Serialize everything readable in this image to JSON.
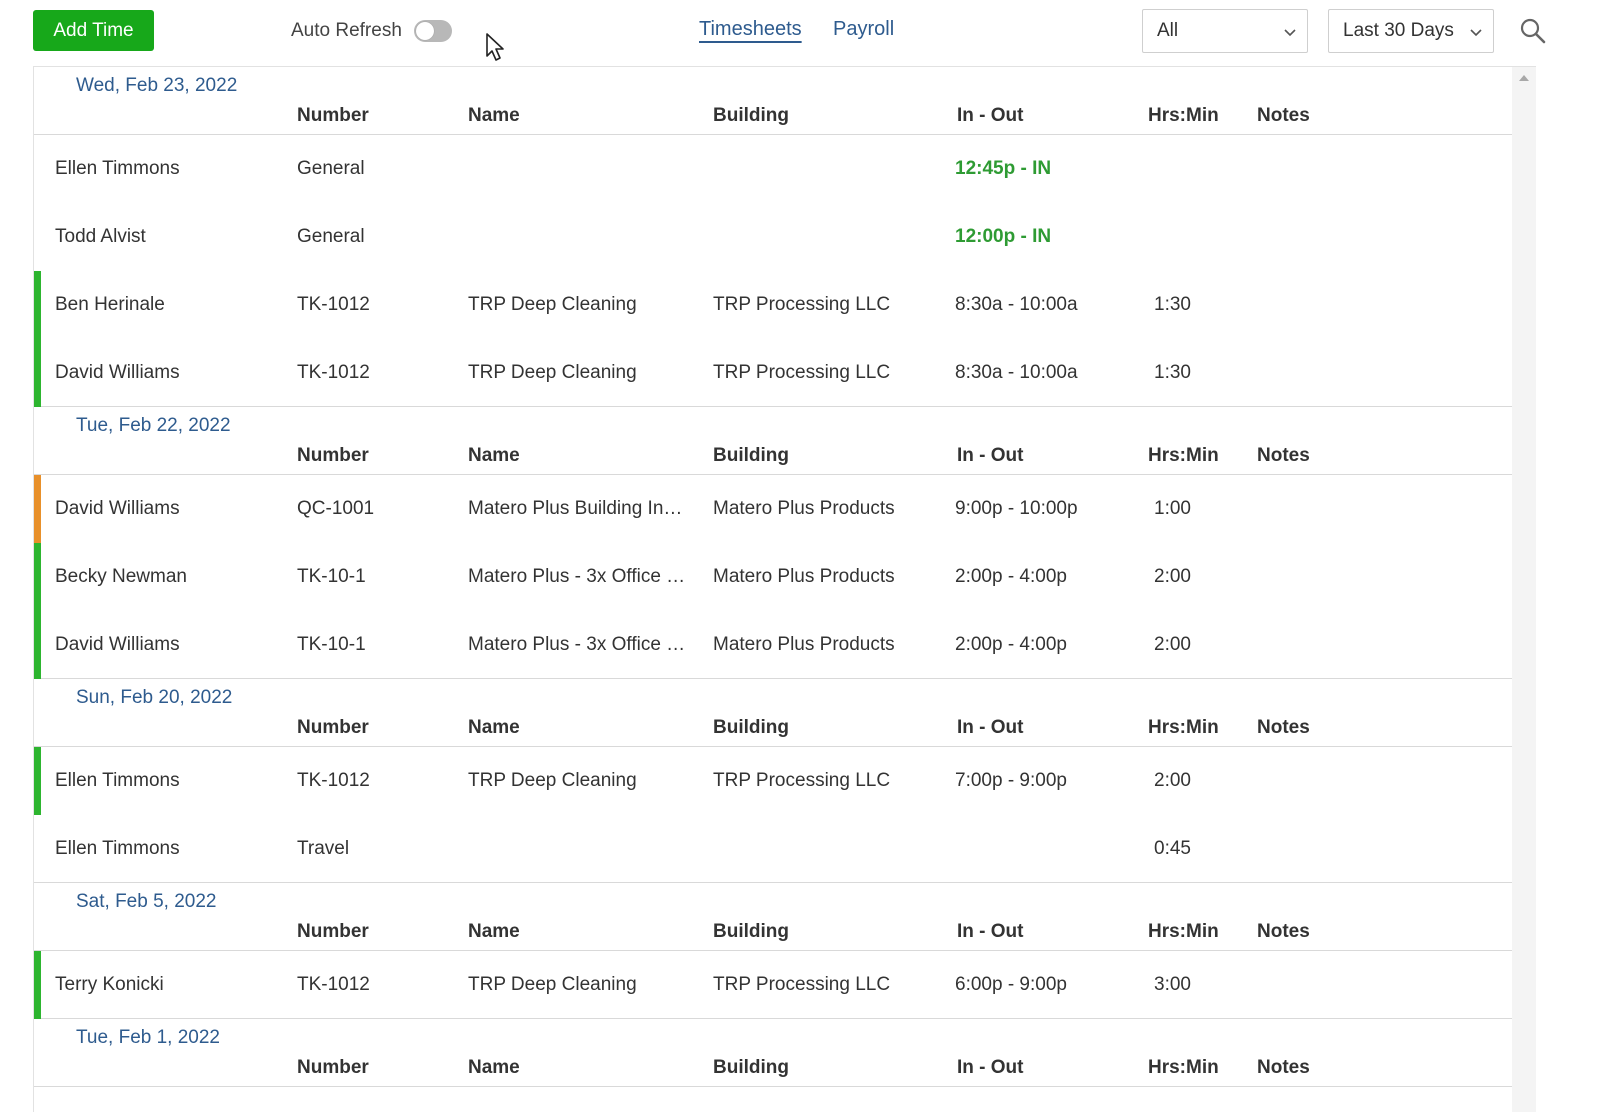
{
  "toolbar": {
    "add_label": "Add Time",
    "auto_refresh_label": "Auto Refresh",
    "tabs": [
      {
        "label": "Timesheets"
      },
      {
        "label": "Payroll"
      }
    ],
    "filter_value": "All",
    "range_value": "Last 30 Days"
  },
  "columns": {
    "number": "Number",
    "name": "Name",
    "building": "Building",
    "inout": "In - Out",
    "hrs": "Hrs:Min",
    "notes": "Notes"
  },
  "colors": {
    "accent": "#17a81a",
    "link": "#2e5b8e",
    "bar_green": "#2db52f",
    "bar_orange": "#e8902a",
    "clock_in": "#2e9b33"
  },
  "groups": [
    {
      "date": "Wed, Feb 23, 2022",
      "rows": [
        {
          "employee": "Ellen Timmons",
          "number": "General",
          "name": "",
          "building": "",
          "inout": "12:45p - IN",
          "hrs": "",
          "clock_in": true,
          "bar": ""
        },
        {
          "employee": "Todd Alvist",
          "number": "General",
          "name": "",
          "building": "",
          "inout": "12:00p - IN",
          "hrs": "",
          "clock_in": true,
          "bar": ""
        },
        {
          "employee": "Ben Herinale",
          "number": "TK-1012",
          "name": "TRP Deep Cleaning",
          "building": "TRP Processing LLC",
          "inout": "8:30a - 10:00a",
          "hrs": "1:30",
          "clock_in": false,
          "bar": "green"
        },
        {
          "employee": "David Williams",
          "number": "TK-1012",
          "name": "TRP Deep Cleaning",
          "building": "TRP Processing LLC",
          "inout": "8:30a - 10:00a",
          "hrs": "1:30",
          "clock_in": false,
          "bar": "green"
        }
      ]
    },
    {
      "date": "Tue, Feb 22, 2022",
      "rows": [
        {
          "employee": "David Williams",
          "number": "QC-1001",
          "name": "Matero Plus Building In…",
          "building": "Matero Plus Products",
          "inout": "9:00p - 10:00p",
          "hrs": "1:00",
          "clock_in": false,
          "bar": "orange"
        },
        {
          "employee": "Becky Newman",
          "number": "TK-10-1",
          "name": "Matero Plus - 3x Office …",
          "building": "Matero Plus Products",
          "inout": "2:00p - 4:00p",
          "hrs": "2:00",
          "clock_in": false,
          "bar": "green"
        },
        {
          "employee": "David Williams",
          "number": "TK-10-1",
          "name": "Matero Plus - 3x Office …",
          "building": "Matero Plus Products",
          "inout": "2:00p - 4:00p",
          "hrs": "2:00",
          "clock_in": false,
          "bar": "green"
        }
      ]
    },
    {
      "date": "Sun, Feb 20, 2022",
      "rows": [
        {
          "employee": "Ellen Timmons",
          "number": "TK-1012",
          "name": "TRP Deep Cleaning",
          "building": "TRP Processing LLC",
          "inout": "7:00p - 9:00p",
          "hrs": "2:00",
          "clock_in": false,
          "bar": "green"
        },
        {
          "employee": "Ellen Timmons",
          "number": "Travel",
          "name": "",
          "building": "",
          "inout": "",
          "hrs": "0:45",
          "clock_in": false,
          "bar": ""
        }
      ]
    },
    {
      "date": "Sat, Feb 5, 2022",
      "rows": [
        {
          "employee": "Terry Konicki",
          "number": "TK-1012",
          "name": "TRP Deep Cleaning",
          "building": "TRP Processing LLC",
          "inout": "6:00p - 9:00p",
          "hrs": "3:00",
          "clock_in": false,
          "bar": "green"
        }
      ]
    },
    {
      "date": "Tue, Feb 1, 2022",
      "rows": []
    }
  ]
}
